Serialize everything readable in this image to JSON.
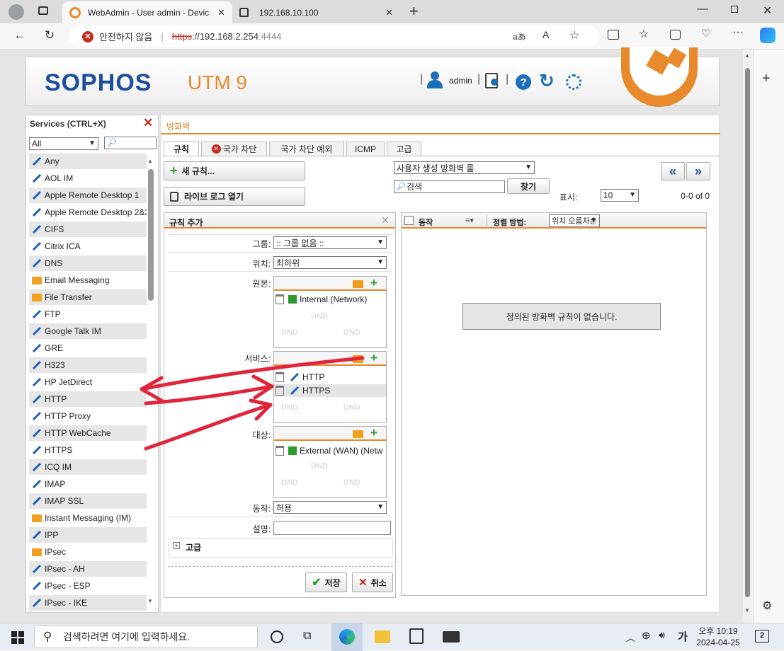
{
  "browser": {
    "tabs": [
      {
        "title": "WebAdmin - User admin - Devic"
      },
      {
        "title": "192.168.10.100"
      }
    ],
    "address": {
      "warning": "안전하지 않음",
      "scheme": "https",
      "host": "://192.168.2.254",
      "port": ":4444"
    }
  },
  "header": {
    "logo": "SOPHOS",
    "product": "UTM 9",
    "user": "admin"
  },
  "sidebar": {
    "title": "Services (CTRL+X)",
    "filter_value": "All",
    "items": [
      {
        "label": "Any",
        "icon": "service-icon"
      },
      {
        "label": "AOL IM",
        "icon": "service-icon"
      },
      {
        "label": "Apple Remote Desktop 1",
        "icon": "service-icon"
      },
      {
        "label": "Apple Remote Desktop 2&3",
        "icon": "service-icon"
      },
      {
        "label": "CIFS",
        "icon": "service-icon"
      },
      {
        "label": "Citrix ICA",
        "icon": "service-icon"
      },
      {
        "label": "DNS",
        "icon": "service-icon"
      },
      {
        "label": "Email Messaging",
        "icon": "service-group-icon"
      },
      {
        "label": "File Transfer",
        "icon": "service-group-icon"
      },
      {
        "label": "FTP",
        "icon": "service-icon"
      },
      {
        "label": "Google Talk IM",
        "icon": "service-icon"
      },
      {
        "label": "GRE",
        "icon": "service-icon"
      },
      {
        "label": "H323",
        "icon": "service-icon"
      },
      {
        "label": "HP JetDirect",
        "icon": "service-icon"
      },
      {
        "label": "HTTP",
        "icon": "service-icon"
      },
      {
        "label": "HTTP Proxy",
        "icon": "service-icon"
      },
      {
        "label": "HTTP WebCache",
        "icon": "service-icon"
      },
      {
        "label": "HTTPS",
        "icon": "service-icon"
      },
      {
        "label": "ICQ IM",
        "icon": "service-icon"
      },
      {
        "label": "IMAP",
        "icon": "service-icon"
      },
      {
        "label": "IMAP SSL",
        "icon": "service-icon"
      },
      {
        "label": "Instant Messaging (IM)",
        "icon": "service-group-icon"
      },
      {
        "label": "IPP",
        "icon": "service-icon"
      },
      {
        "label": "IPsec",
        "icon": "service-group-icon"
      },
      {
        "label": "IPsec - AH",
        "icon": "service-icon"
      },
      {
        "label": "IPsec - ESP",
        "icon": "service-icon"
      },
      {
        "label": "IPsec - IKE",
        "icon": "service-icon"
      }
    ]
  },
  "main": {
    "breadcrumb": "방화벽",
    "tabs": [
      {
        "label": "규칙"
      },
      {
        "label": "국가 차단"
      },
      {
        "label": "국가 차단 예외"
      },
      {
        "label": "ICMP"
      },
      {
        "label": "고급"
      }
    ],
    "new_rule_label": "새 규칙...",
    "live_log_label": "라이브 로그 열기",
    "view_select": "사용자 생성 방화벽 룰",
    "search_placeholder": "검색",
    "find_label": "찾기",
    "display_label": "표시:",
    "display_value": "10",
    "page_count": "0-0 of 0",
    "add_rule": {
      "title": "규칙 추가",
      "group_label": "그룹:",
      "group_value": ":: 그룹 없음 ::",
      "position_label": "위치:",
      "position_value": "최하위",
      "source_label": "원본:",
      "source_items": [
        "Internal (Network)"
      ],
      "services_label": "서비스:",
      "services_items": [
        "HTTP",
        "HTTPS"
      ],
      "dest_label": "대상:",
      "dest_items": [
        "External (WAN) (Netw"
      ],
      "dnd": "DND",
      "action_label": "동작:",
      "action_value": "허용",
      "comment_label": "설명:",
      "advanced_label": "고급",
      "save_label": "저장",
      "cancel_label": "취소"
    },
    "rules_list": {
      "action_col": "동작",
      "sort_label": "정렬 방법:",
      "sort_value": "위치 오름차순",
      "empty_message": "정의된 방화벽 규칙이 없습니다."
    }
  },
  "taskbar": {
    "search_placeholder": "검색하려면 여기에 입력하세요.",
    "time": "오후 10:19",
    "date": "2024-04-25",
    "notif_count": "2"
  },
  "colors": {
    "accent": "#e8892b",
    "brand": "#1c4e9c",
    "annotation": "#e0243a"
  }
}
